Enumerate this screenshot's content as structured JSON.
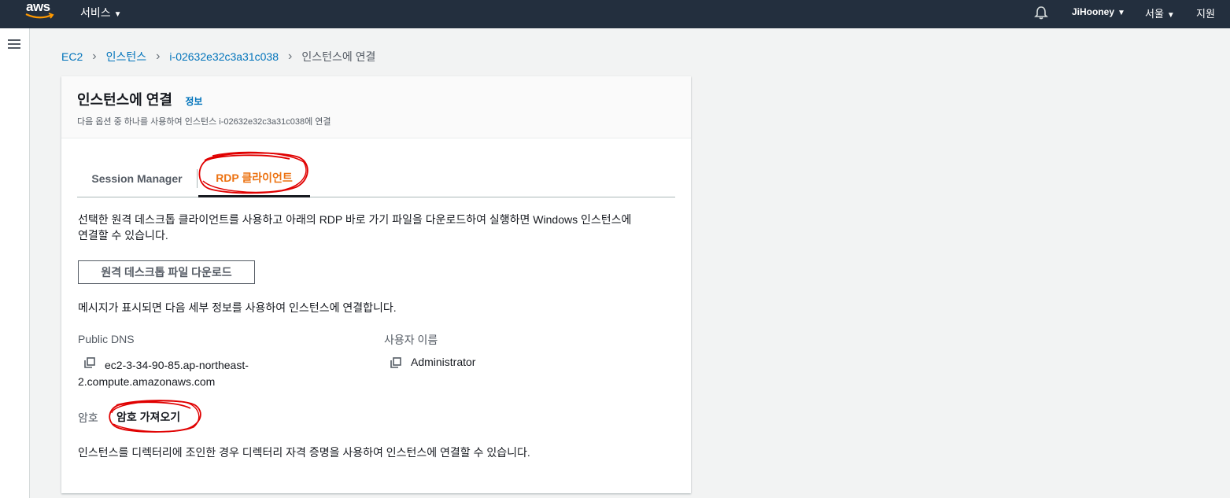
{
  "topnav": {
    "logo_text": "aws",
    "services_label": "서비스",
    "user_label": "JiHooney",
    "region_label": "서울",
    "support_label": "지원"
  },
  "breadcrumb": {
    "items": [
      "EC2",
      "인스턴스",
      "i-02632e32c3a31c038",
      "인스턴스에 연결"
    ]
  },
  "panel": {
    "title": "인스턴스에 연결",
    "info_link": "정보",
    "description": "다음 옵션 중 하나를 사용하여 인스턴스 i-02632e32c3a31c038에 연결"
  },
  "tabs": {
    "session_manager": "Session Manager",
    "rdp_client": "RDP 클라이언트",
    "active": "RDP 클라이언트"
  },
  "rdp": {
    "intro_line1": "선택한 원격 데스크톱 클라이언트를 사용하고 아래의 RDP 바로 가기 파일을 다운로드하여 실행하면 Windows 인스턴스에",
    "intro_line2": "연결할 수 있습니다.",
    "download_button": "원격 데스크톱 파일 다운로드",
    "prompt_text": "메시지가 표시되면 다음 세부 정보를 사용하여 인스턴스에 연결합니다.",
    "public_dns_label": "Public DNS",
    "public_dns_value_line1": "ec2-3-34-90-85.ap-northeast-",
    "public_dns_value_line2": "2.compute.amazonaws.com",
    "username_label": "사용자 이름",
    "username_value": "Administrator",
    "password_label": "암호",
    "password_link": "암호 가져오기",
    "directory_text": "인스턴스를 디렉터리에 조인한 경우 디렉터리 자격 증명을 사용하여 인스턴스에 연결할 수 있습니다."
  },
  "colors": {
    "nav_bg": "#232f3e",
    "link": "#0073bb",
    "active_tab": "#ec7211",
    "annotation": "#e00000"
  }
}
